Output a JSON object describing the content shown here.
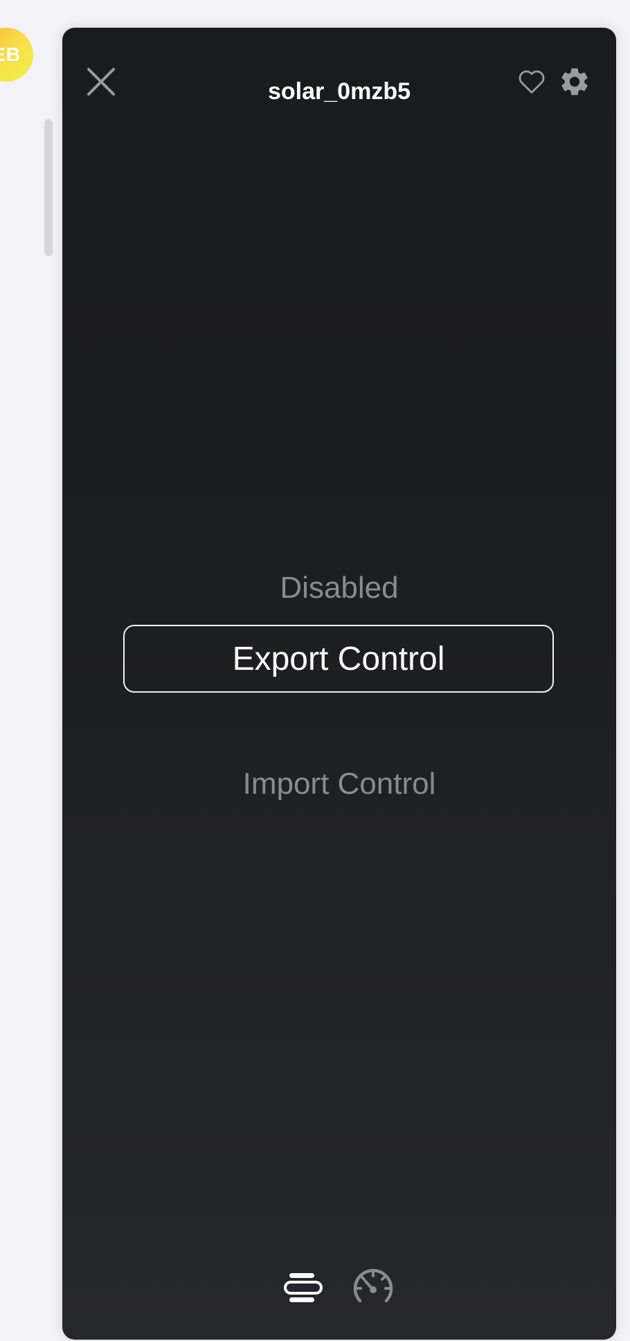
{
  "background": {
    "avatar_initials": "EB"
  },
  "dialog": {
    "title": "solar_0mzb5",
    "icons": {
      "close": "close-icon",
      "favorite": "heart-icon",
      "settings": "gear-icon"
    },
    "options": [
      {
        "label": "Disabled",
        "selected": false
      },
      {
        "label": "Export Control",
        "selected": true
      },
      {
        "label": "Import Control",
        "selected": false
      }
    ],
    "bottom_nav": {
      "list_icon": "list-icon",
      "gauge_icon": "gauge-icon"
    }
  },
  "colors": {
    "panel_bg": "#1c1d21",
    "selected_text": "#ffffff",
    "unselected_text": "#8a8b90"
  }
}
